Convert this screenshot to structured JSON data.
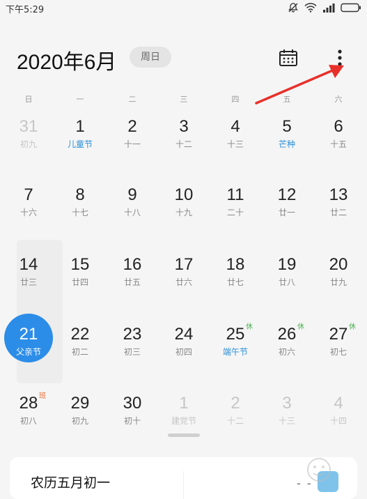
{
  "status": {
    "time": "下午5:29"
  },
  "header": {
    "month_title": "2020年6月",
    "weekday_chip": "周日"
  },
  "weekdays": [
    "日",
    "一",
    "二",
    "三",
    "四",
    "五",
    "六"
  ],
  "weeks": [
    [
      {
        "num": "31",
        "sub": "初九",
        "muted": true
      },
      {
        "num": "1",
        "sub": "儿童节",
        "holiday": true
      },
      {
        "num": "2",
        "sub": "十一"
      },
      {
        "num": "3",
        "sub": "十二"
      },
      {
        "num": "4",
        "sub": "十三"
      },
      {
        "num": "5",
        "sub": "芒种",
        "holiday": true
      },
      {
        "num": "6",
        "sub": "十五"
      }
    ],
    [
      {
        "num": "7",
        "sub": "十六"
      },
      {
        "num": "8",
        "sub": "十七"
      },
      {
        "num": "9",
        "sub": "十八"
      },
      {
        "num": "10",
        "sub": "十九"
      },
      {
        "num": "11",
        "sub": "二十"
      },
      {
        "num": "12",
        "sub": "廿一"
      },
      {
        "num": "13",
        "sub": "廿二"
      }
    ],
    [
      {
        "num": "14",
        "sub": "廿三"
      },
      {
        "num": "15",
        "sub": "廿四"
      },
      {
        "num": "16",
        "sub": "廿五"
      },
      {
        "num": "17",
        "sub": "廿六"
      },
      {
        "num": "18",
        "sub": "廿七"
      },
      {
        "num": "19",
        "sub": "廿八"
      },
      {
        "num": "20",
        "sub": "廿九"
      }
    ],
    [
      {
        "num": "21",
        "sub": "父亲节",
        "selected": true
      },
      {
        "num": "22",
        "sub": "初二"
      },
      {
        "num": "23",
        "sub": "初三"
      },
      {
        "num": "24",
        "sub": "初四"
      },
      {
        "num": "25",
        "sub": "端午节",
        "holiday": true,
        "badge": "休"
      },
      {
        "num": "26",
        "sub": "初六",
        "badge": "休"
      },
      {
        "num": "27",
        "sub": "初七",
        "badge": "休"
      }
    ],
    [
      {
        "num": "28",
        "sub": "初八",
        "badge": "班",
        "badge_work": true
      },
      {
        "num": "29",
        "sub": "初九"
      },
      {
        "num": "30",
        "sub": "初十"
      },
      {
        "num": "1",
        "sub": "建党节",
        "muted": true
      },
      {
        "num": "2",
        "sub": "十二",
        "muted": true
      },
      {
        "num": "3",
        "sub": "十三",
        "muted": true
      },
      {
        "num": "4",
        "sub": "十四",
        "muted": true
      }
    ]
  ],
  "info_card": {
    "lunar_date": "农历五月初一",
    "weather_value": "- -"
  },
  "colors": {
    "accent": "#2c8de8",
    "holiday": "#2a8fd6",
    "rest_badge": "#4caf50",
    "work_badge": "#f06a37",
    "annotation_arrow": "#e8302a"
  },
  "icons": {
    "calendar": "calendar-icon",
    "more": "more-vertical-icon",
    "weather": "weather-icon"
  }
}
